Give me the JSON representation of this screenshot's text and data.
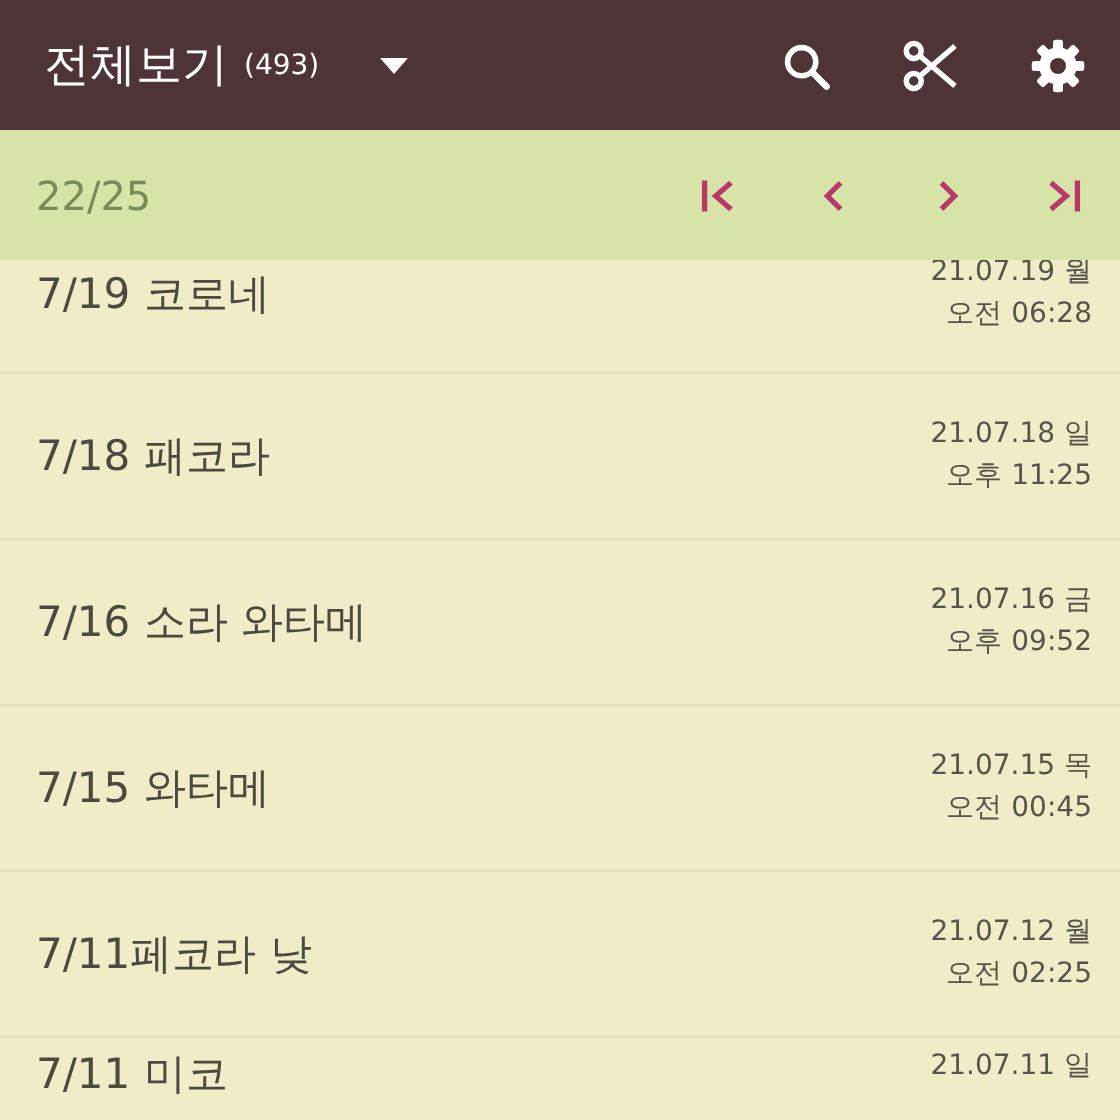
{
  "app_bar": {
    "title": "전체보기",
    "count": "(493)"
  },
  "pager": {
    "position": "22/25"
  },
  "entries": [
    {
      "title": "7/19 코로네",
      "date": "21.07.19 월",
      "time": "오전 06:28"
    },
    {
      "title": "7/18 패코라",
      "date": "21.07.18 일",
      "time": "오후 11:25"
    },
    {
      "title": "7/16 소라 와타메",
      "date": "21.07.16 금",
      "time": "오후 09:52"
    },
    {
      "title": "7/15 와타메",
      "date": "21.07.15 목",
      "time": "오전 00:45"
    },
    {
      "title": "7/11페코라 낮",
      "date": "21.07.12 월",
      "time": "오전 02:25"
    },
    {
      "title": "7/11 미코",
      "date": "21.07.11 일"
    }
  ]
}
